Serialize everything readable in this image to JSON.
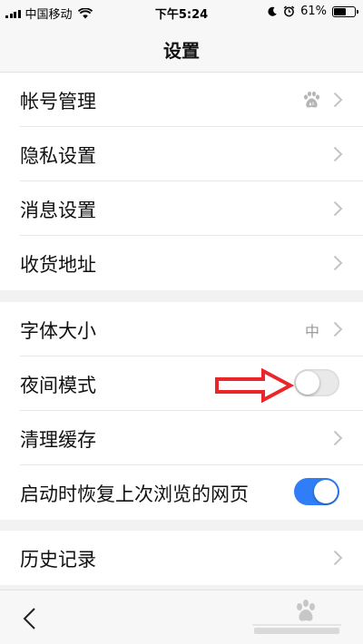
{
  "status_bar": {
    "carrier": "中国移动",
    "time": "下午5:24",
    "battery_text": "61%",
    "battery_level": 0.61
  },
  "nav": {
    "title": "设置"
  },
  "groups": [
    {
      "items": [
        {
          "label": "帐号管理",
          "accessory": "chevron",
          "icon": "baidu-paw-icon"
        },
        {
          "label": "隐私设置",
          "accessory": "chevron"
        },
        {
          "label": "消息设置",
          "accessory": "chevron"
        },
        {
          "label": "收货地址",
          "accessory": "chevron"
        }
      ]
    },
    {
      "items": [
        {
          "label": "字体大小",
          "accessory": "chevron",
          "value": "中"
        },
        {
          "label": "夜间模式",
          "accessory": "toggle",
          "toggle_on": false
        },
        {
          "label": "清理缓存",
          "accessory": "chevron"
        },
        {
          "label": "启动时恢复上次浏览的网页",
          "accessory": "toggle",
          "toggle_on": true
        }
      ]
    },
    {
      "items": [
        {
          "label": "历史记录",
          "accessory": "chevron"
        }
      ]
    }
  ],
  "colors": {
    "toggle_on": "#2f7ef7",
    "annotation_arrow": "#e8262b",
    "chevron": "#c4c4c4"
  },
  "icons": {
    "back": "back-chevron-icon",
    "annotation": "red-arrow-annotation-icon"
  }
}
